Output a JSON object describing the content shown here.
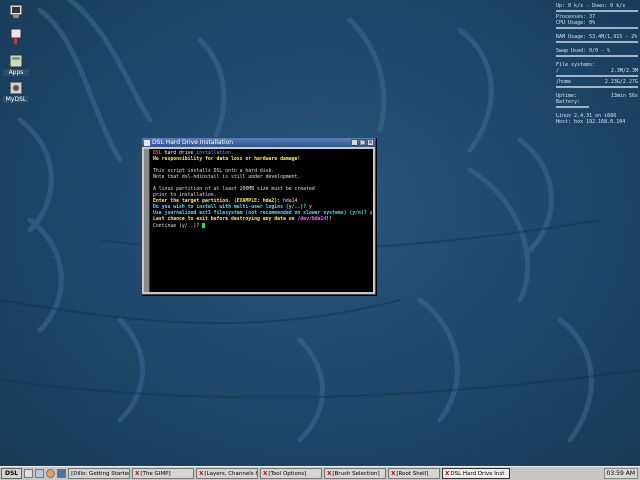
{
  "desktop": {
    "icons": [
      {
        "label": "",
        "icon": "terminal-icon"
      },
      {
        "label": "",
        "icon": "shortcut-icon"
      },
      {
        "label": "Apps",
        "icon": "apps-icon"
      },
      {
        "label": "MyDSL",
        "icon": "mydsl-icon"
      }
    ]
  },
  "sysmon": {
    "net": "Up: 0 k/s - Down: 0 k/s",
    "processes": "Processes: 37",
    "cpu": "CPU Usage: 0%",
    "ram": "RAM Usage: 53.4M/1,915 - 2%",
    "swap": "Swap Used: 0/0 - %",
    "fs_header": "File systems:",
    "fs_root_name": "/",
    "fs_root_val": "2.3M/2.3M",
    "fs_home_name": "/home",
    "fs_home_val": "2.23G/2.27G",
    "uptime_label": "Uptime:",
    "uptime_val": "13min 56s",
    "battery_label": "Battery:",
    "kernel": "Linux 2.4.31 on i686",
    "host": "Host: box 192.168.0.104"
  },
  "window": {
    "title": "DSL Hard Drive Installation",
    "btn_min": "_",
    "btn_max": "□",
    "btn_close": "×"
  },
  "terminal": {
    "l1_a": "DSL",
    "l1_b": " hard drive ",
    "l1_c": "installation.",
    "l2": "No responsibility for data loss or hardware damage!",
    "l3": "This script installs DSL onto a hard disk.",
    "l4": "Note that dsl-hdinstall is still under development.",
    "l5": "A linux partition of at least 200MB size must be created",
    "l6": "prior to installation.",
    "l7_prompt": "Enter the target partition. (EXAMPLE: hda2): ",
    "l7_ans": "hda14",
    "l8_prompt": "Do you wish to install with multi-user logins (y/..)? ",
    "l8_ans": "y",
    "l9_prompt": "Use journalized ext3 filesystem (not recommended on slower systems) (y/n)? ",
    "l9_ans": "y",
    "l10_prompt": "Last chance to exit before destroying any data on ",
    "l10_dev": "/dev/hda14",
    "l10_end": "!!",
    "l11": "Continue (y/..)? "
  },
  "taskbar": {
    "start_label": "DSL",
    "tasks": [
      {
        "label": "[Dillo: Getting Started]",
        "x": false
      },
      {
        "label": "[The GIMP]",
        "x": true
      },
      {
        "label": "[Layers, Channels & P",
        "x": true
      },
      {
        "label": "[Tool Options]",
        "x": true
      },
      {
        "label": "[Brush Selection]",
        "x": true
      },
      {
        "label": "[Root Shell]",
        "x": true
      },
      {
        "label": "DSL Hard Drive Inst",
        "x": true
      }
    ],
    "clock": "03:59 AM"
  }
}
